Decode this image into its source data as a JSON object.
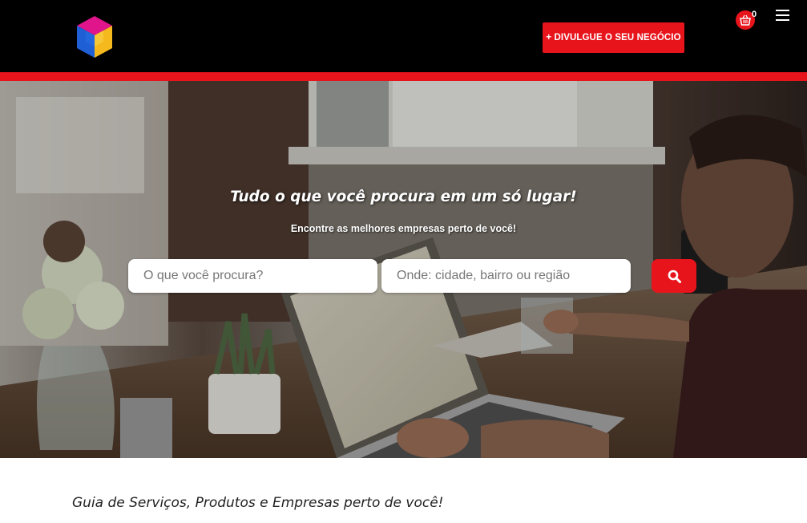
{
  "header": {
    "cta_label": "+ DIVULGUE O SEU NEGÓCIO",
    "cart_count": "0",
    "brand_colors": {
      "red": "#e8141c",
      "black": "#000000"
    },
    "logo_icon": "cube-logo-icon",
    "cart_icon": "basket-icon",
    "menu_icon": "hamburger-menu-icon"
  },
  "hero": {
    "title": "Tudo o que você procura em um só lugar!",
    "subtitle": "Encontre as melhores empresas perto de você!",
    "what_placeholder": "O que você procura?",
    "where_placeholder": "Onde: cidade, bairro ou região",
    "search_icon": "search-icon"
  },
  "main": {
    "tagline": "Guia de Serviços, Produtos e Empresas perto de você!"
  }
}
